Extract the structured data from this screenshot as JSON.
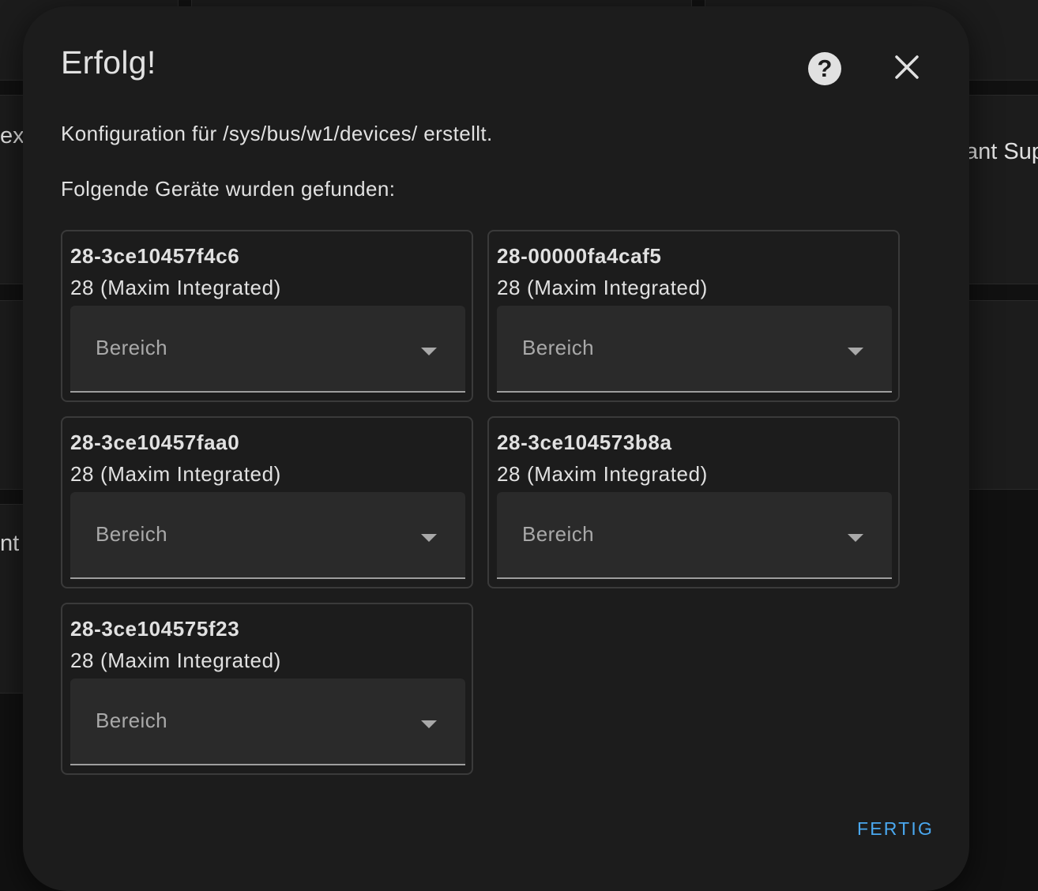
{
  "background": {
    "left_texts": [
      "ex",
      "nt"
    ],
    "right_text": "ant Sup"
  },
  "dialog": {
    "title": "Erfolg!",
    "help_icon": "help-circle-icon",
    "help_glyph": "?",
    "close_icon": "close-icon",
    "intro_line_1": "Konfiguration für /sys/bus/w1/devices/ erstellt.",
    "intro_line_2": "Folgende Geräte wurden gefunden:",
    "devices": [
      {
        "id": "28-3ce10457f4c6",
        "type": "28 (Maxim Integrated)",
        "area_label": "Bereich"
      },
      {
        "id": "28-00000fa4caf5",
        "type": "28 (Maxim Integrated)",
        "area_label": "Bereich"
      },
      {
        "id": "28-3ce10457faa0",
        "type": "28 (Maxim Integrated)",
        "area_label": "Bereich"
      },
      {
        "id": "28-3ce104573b8a",
        "type": "28 (Maxim Integrated)",
        "area_label": "Bereich"
      },
      {
        "id": "28-3ce104575f23",
        "type": "28 (Maxim Integrated)",
        "area_label": "Bereich"
      }
    ],
    "done_label": "FERTIG"
  },
  "colors": {
    "dialog_bg": "#1c1c1c",
    "text": "#e1e1e1",
    "accent": "#4aa8f0",
    "field_bg": "#2a2a2a"
  }
}
